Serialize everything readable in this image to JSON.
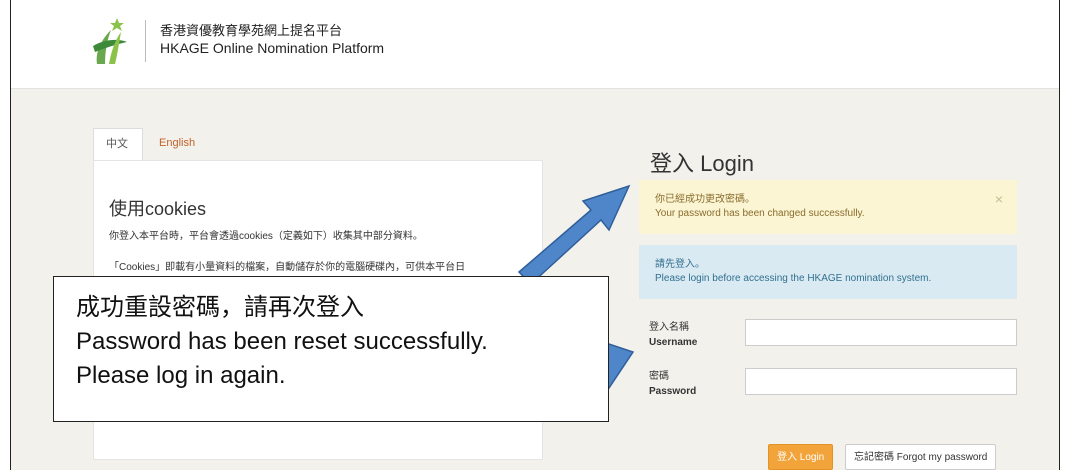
{
  "header": {
    "brand_zh": "香港資優教育學苑網上提名平台",
    "brand_en": "HKAGE Online Nomination Platform"
  },
  "tabs": [
    {
      "label": "中文"
    },
    {
      "label": "English"
    }
  ],
  "cookies": {
    "title": "使用cookies",
    "p1": "你登入本平台時，平台會透過cookies（定義如下）收集其中部分資料。",
    "p2": "「Cookies」即載有小量資料的檔案，自動儲存於你的電腦硬碟內，可供本平台日"
  },
  "callout": {
    "line1": "成功重設密碼，請再次登入",
    "line2": "Password has been reset successfully.",
    "line3": "Please log in again."
  },
  "login": {
    "title": "登入 Login",
    "success_zh": "你已經成功更改密碼。",
    "success_en": "Your password has been changed successfully.",
    "close": "×",
    "info_zh": "請先登入。",
    "info_en": "Please login before accessing the HKAGE nomination system.",
    "username_zh": "登入名稱",
    "username_en": "Username",
    "password_zh": "密碼",
    "password_en": "Password",
    "username_value": "",
    "password_value": "",
    "login_button": "登入 Login",
    "forgot_button": "忘記密碼 Forgot my password"
  },
  "colors": {
    "accent_orange": "#f2a33a",
    "alert_success_bg": "#fbf5d3",
    "alert_info_bg": "#daeaf3",
    "arrow_blue": "#4f86c9"
  },
  "icons": [
    "hkage-logo-icon",
    "close-icon",
    "callout-arrow-icon"
  ]
}
